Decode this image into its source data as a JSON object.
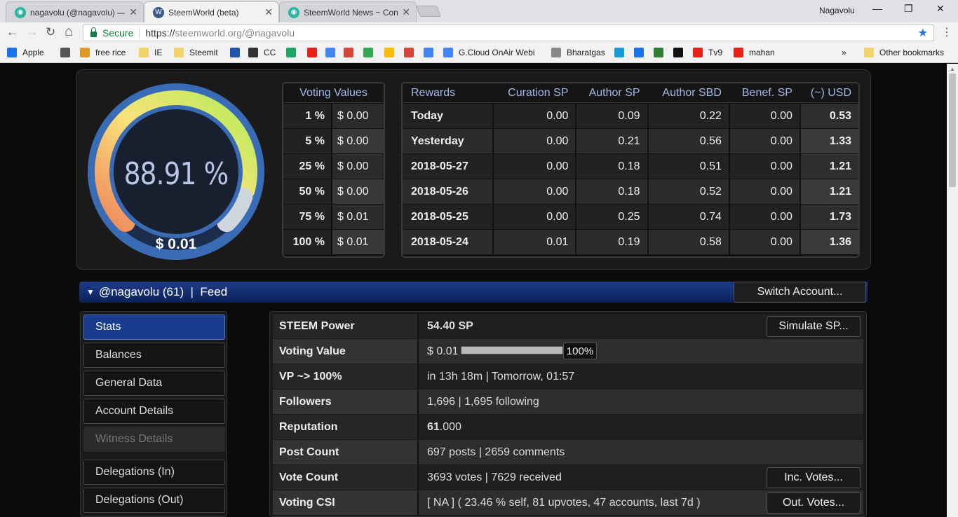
{
  "browser": {
    "tabs": [
      {
        "title": "nagavolu (@nagavolu) —",
        "active": false,
        "favicon_color": "#2bb5a0"
      },
      {
        "title": "SteemWorld (beta)",
        "active": true,
        "favicon_color": "#3b5a8a"
      },
      {
        "title": "SteemWorld News ~ Con",
        "active": false,
        "favicon_color": "#2bb5a0"
      }
    ],
    "close_glyph": "✕",
    "user": "Nagavolu",
    "window_controls": {
      "minimize": "—",
      "maximize": "❐",
      "close": "✕"
    },
    "nav": {
      "back": "←",
      "forward": "→",
      "reload": "↻",
      "home": "⌂"
    },
    "secure_label": "Secure",
    "url_proto": "https://",
    "url_rest": "steemworld.org/@nagavolu",
    "bookmarks": [
      {
        "label": "Apple",
        "icon_color": "#1a73e8"
      },
      {
        "label": "",
        "icon_color": "#555555"
      },
      {
        "label": "free rice",
        "icon_color": "#d99a2b"
      },
      {
        "label": "IE",
        "icon_color": "#f3d36b"
      },
      {
        "label": "Steemit",
        "icon_color": "#f3d36b"
      },
      {
        "label": "",
        "icon_color": "#2255aa"
      },
      {
        "label": "CC",
        "icon_color": "#333333"
      },
      {
        "label": "",
        "icon_color": "#1fa463"
      },
      {
        "label": "",
        "icon_color": "#e62117"
      },
      {
        "label": "",
        "icon_color": "#4285f4"
      },
      {
        "label": "",
        "icon_color": "#d44638"
      },
      {
        "label": "",
        "icon_color": "#34a853"
      },
      {
        "label": "",
        "icon_color": "#fbbc05"
      },
      {
        "label": "",
        "icon_color": "#d44638"
      },
      {
        "label": "",
        "icon_color": "#4285f4"
      },
      {
        "label": "G.Cloud OnAir Webi",
        "icon_color": "#4285f4"
      },
      {
        "label": "Bharatgas",
        "icon_color": "#888888"
      },
      {
        "label": "",
        "icon_color": "#1a9ad6"
      },
      {
        "label": "",
        "icon_color": "#1a73e8"
      },
      {
        "label": "",
        "icon_color": "#2e7d32"
      },
      {
        "label": "",
        "icon_color": "#111111"
      },
      {
        "label": "Tv9",
        "icon_color": "#e62117"
      },
      {
        "label": "mahan",
        "icon_color": "#e62117"
      }
    ],
    "overflow": "»",
    "other_bookmarks": "Other bookmarks"
  },
  "gauge": {
    "percent_text": "88.91 %",
    "usd_text": "$ 0.01",
    "fraction": 0.8891
  },
  "voting_values": {
    "header": "Voting Values",
    "rows": [
      {
        "pct": "1 %",
        "val": "$ 0.00"
      },
      {
        "pct": "5 %",
        "val": "$ 0.00"
      },
      {
        "pct": "25 %",
        "val": "$ 0.00"
      },
      {
        "pct": "50 %",
        "val": "$ 0.00"
      },
      {
        "pct": "75 %",
        "val": "$ 0.01"
      },
      {
        "pct": "100 %",
        "val": "$ 0.01"
      }
    ]
  },
  "rewards": {
    "headers": [
      "Rewards",
      "Curation SP",
      "Author SP",
      "Author SBD",
      "Benef. SP",
      "(~) USD"
    ],
    "rows": [
      [
        "Today",
        "0.00",
        "0.09",
        "0.22",
        "0.00",
        "0.53"
      ],
      [
        "Yesterday",
        "0.00",
        "0.21",
        "0.56",
        "0.00",
        "1.33"
      ],
      [
        "2018-05-27",
        "0.00",
        "0.18",
        "0.51",
        "0.00",
        "1.21"
      ],
      [
        "2018-05-26",
        "0.00",
        "0.18",
        "0.52",
        "0.00",
        "1.21"
      ],
      [
        "2018-05-25",
        "0.00",
        "0.25",
        "0.74",
        "0.00",
        "1.73"
      ],
      [
        "2018-05-24",
        "0.01",
        "0.19",
        "0.58",
        "0.00",
        "1.36"
      ]
    ]
  },
  "account_bar": {
    "caret": "▼",
    "label": "@nagavolu (61)  |  Feed",
    "switch_label": "Switch Account..."
  },
  "sidebar": [
    {
      "label": "Stats",
      "state": "active"
    },
    {
      "label": "Balances",
      "state": "normal"
    },
    {
      "label": "General Data",
      "state": "normal"
    },
    {
      "label": "Account Details",
      "state": "normal"
    },
    {
      "label": "Witness Details",
      "state": "disabled"
    },
    {
      "label": "Delegations (In)",
      "state": "normal"
    },
    {
      "label": "Delegations (Out)",
      "state": "normal"
    }
  ],
  "stats": {
    "steem_power": {
      "label": "STEEM Power",
      "value": "54.40 SP",
      "button": "Simulate SP..."
    },
    "voting_value": {
      "label": "Voting Value",
      "value": "$ 0.01",
      "slider_percent": "100%",
      "slider_fraction": 1.0
    },
    "vp": {
      "label": "VP ~> 100%",
      "value": "in 13h 18m | Tomorrow, 01:57"
    },
    "followers": {
      "label": "Followers",
      "value": "1,696 | 1,695 following"
    },
    "reputation": {
      "label": "Reputation",
      "value_bold": "61",
      "value_rest": ".000"
    },
    "post_count": {
      "label": "Post Count",
      "value": "697 posts | 2659 comments"
    },
    "vote_count": {
      "label": "Vote Count",
      "value": "3693 votes | 7629 received",
      "button": "Inc. Votes..."
    },
    "voting_csi": {
      "label": "Voting CSI",
      "value": "[ NA ] ( 23.46 % self, 81 upvotes, 47 accounts, last 7d )",
      "button": "Out. Votes..."
    }
  }
}
